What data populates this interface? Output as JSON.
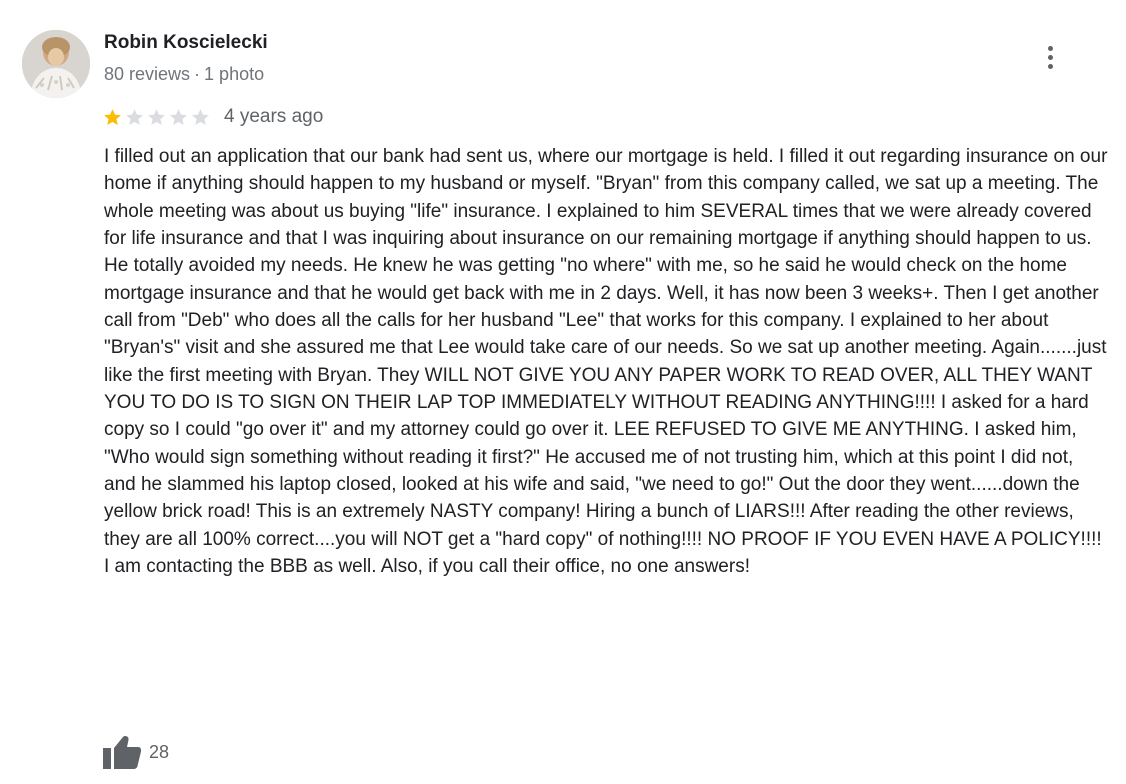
{
  "reviewer": {
    "name": "Robin Koscielecki",
    "reviews_count": "80 reviews",
    "separator": "·",
    "photos_count": "1 photo",
    "avatar_icon": "reviewer-photo"
  },
  "menu": {
    "icon": "more-vert-icon"
  },
  "review": {
    "rating": 1,
    "max_rating": 5,
    "star_filled_color": "#fbbc04",
    "star_empty_color": "#dadce0",
    "date": "4 years ago",
    "text": "I filled out an application that our bank had sent us, where our mortgage is held. I filled it out regarding insurance on our home if anything should happen to my husband or myself. \"Bryan\" from this company called, we sat up a meeting. The whole meeting was about us buying \"life\" insurance. I explained to him SEVERAL times that we were already covered for life insurance and that I was inquiring about insurance on our remaining mortgage if anything should happen to us. He totally avoided my needs. He knew he was getting \"no where\" with me, so he said he would check on the home mortgage insurance and that he would get back with me in 2 days. Well, it has now been 3 weeks+.  Then I get another call from \"Deb\" who does all the calls for her husband \"Lee\" that works for this company. I explained to her about \"Bryan's\" visit and she assured me that Lee would take care of our needs. So we sat up another meeting. Again.......just like the first meeting with Bryan. They WILL NOT GIVE YOU ANY PAPER WORK TO READ OVER,  ALL THEY WANT YOU TO DO IS TO SIGN ON THEIR LAP TOP IMMEDIATELY WITHOUT READING ANYTHING!!!! I asked for a hard copy so I could \"go over it\" and my attorney could go over it. LEE REFUSED TO GIVE ME ANYTHING. I asked him, \"Who would sign something without reading it first?\" He accused me of not trusting him, which at this point I did not, and he slammed his laptop closed, looked at his wife and said, \"we need to go!\" Out the door they went......down the yellow brick road! This is an extremely NASTY company! Hiring a bunch of LIARS!!! After reading the other reviews, they are all 100% correct....you will NOT get a \"hard copy\" of nothing!!!! NO PROOF IF YOU EVEN HAVE A POLICY!!!! I am contacting the BBB as well. Also, if you call their office, no one answers!"
  },
  "likes": {
    "icon": "thumbs-up-icon",
    "count": "28",
    "icon_color": "#5f6368"
  }
}
